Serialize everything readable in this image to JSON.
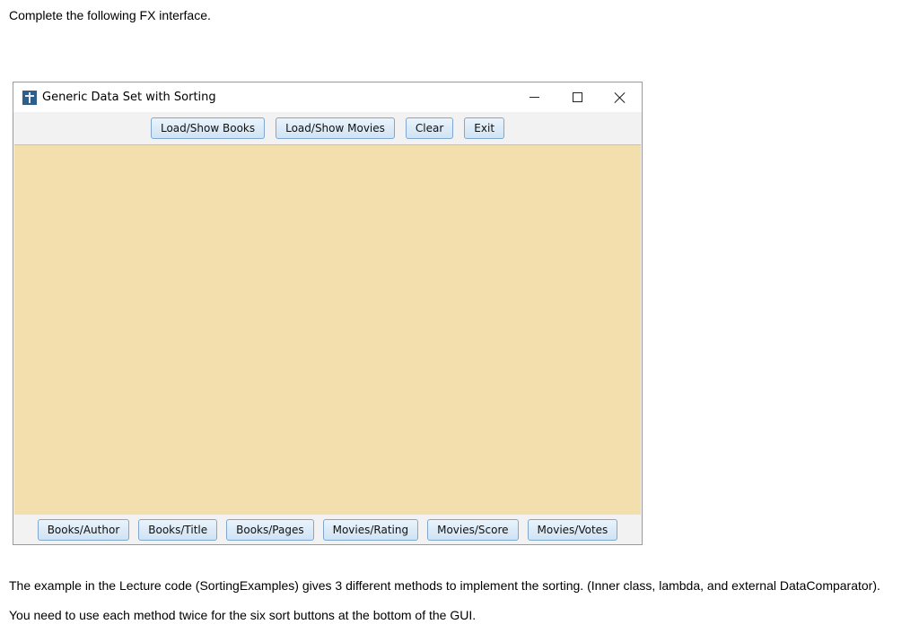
{
  "instructions": {
    "intro": "Complete the following FX interface.",
    "paragraph1": "The example in the Lecture code (SortingExamples) gives 3 different methods to implement the sorting. (Inner class, lambda, and external DataComparator).",
    "paragraph2": "You need to use each method twice for the six sort buttons at the bottom of the GUI."
  },
  "window": {
    "title": "Generic Data Set with Sorting",
    "icon": "app-icon",
    "controls": [
      "minimize-icon",
      "maximize-icon",
      "close-icon"
    ]
  },
  "toolbar": {
    "load_books": "Load/Show Books",
    "load_movies": "Load/Show Movies",
    "clear": "Clear",
    "exit": "Exit"
  },
  "sort_buttons": {
    "books_author": "Books/Author",
    "books_title": "Books/Title",
    "books_pages": "Books/Pages",
    "movies_rating": "Movies/Rating",
    "movies_score": "Movies/Score",
    "movies_votes": "Movies/Votes"
  },
  "colors": {
    "content_background": "#f3deae",
    "button_border": "#7fa7cf"
  }
}
